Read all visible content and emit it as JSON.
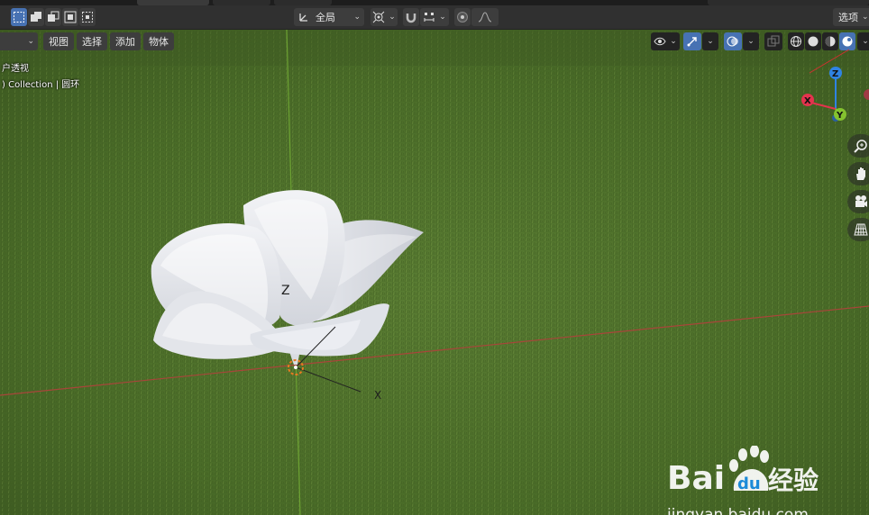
{
  "header": {
    "select_mode_label": "",
    "orientation": {
      "icon": "transform-orientation-icon",
      "label": "全局"
    },
    "options_label": "选项"
  },
  "viewport_header": {
    "mode_label": "",
    "menus": [
      {
        "label": "视图"
      },
      {
        "label": "选择"
      },
      {
        "label": "添加"
      },
      {
        "label": "物体"
      }
    ]
  },
  "overlay_info": {
    "view_name": "户透视",
    "collection_path": ") Collection | 圆环"
  },
  "gizmo": {
    "z_label": "Z",
    "x_label": "X",
    "y_label": "Y",
    "colors": {
      "x": "#e4334d",
      "y": "#84c22f",
      "z": "#2f83e3"
    }
  },
  "scene": {
    "object_z_label": "Z",
    "object_x_label": "X",
    "ground_color": "#4d6f2a",
    "x_axis_color": "#a8453a",
    "y_axis_color": "#6da233"
  },
  "watermark": {
    "brand": "Bai",
    "brand2": "du",
    "jingyan": "经验",
    "url": "jingyan.baidu.com"
  }
}
